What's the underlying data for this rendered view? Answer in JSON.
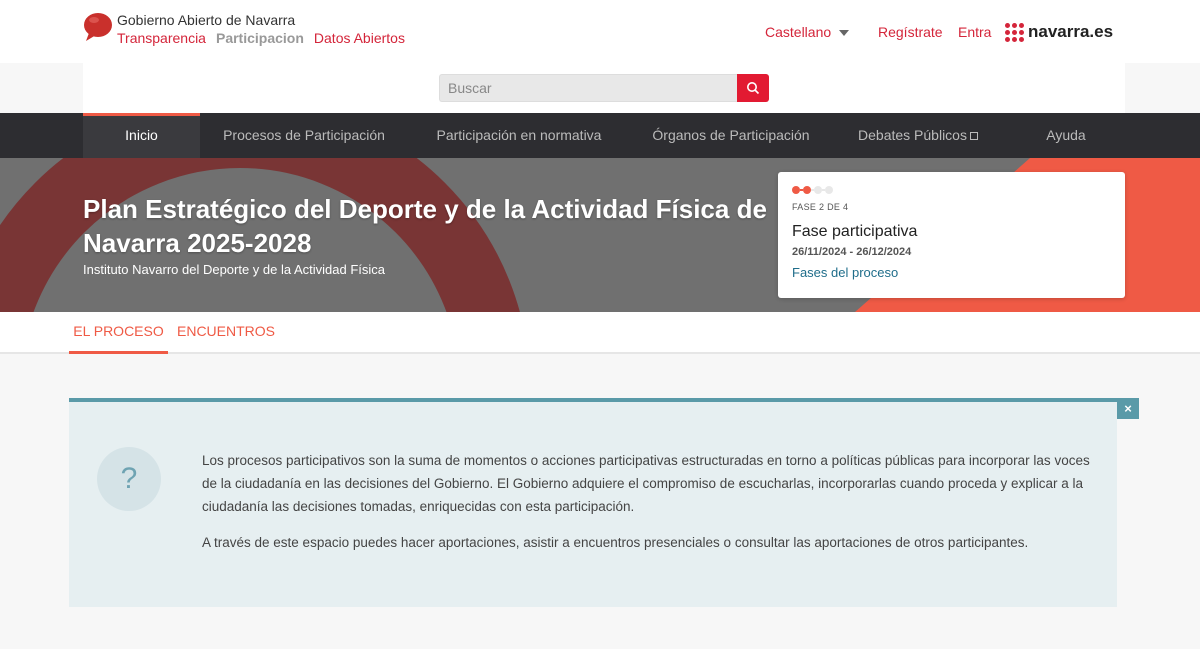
{
  "header": {
    "site_title": "Gobierno Abierto de Navarra",
    "subnav": [
      {
        "label": "Transparencia",
        "active": false
      },
      {
        "label": "Participacion",
        "active": true
      },
      {
        "label": "Datos Abiertos",
        "active": false
      }
    ],
    "language": "Castellano",
    "register": "Regístrate",
    "login": "Entra",
    "brand": "navarra.es"
  },
  "search": {
    "placeholder": "Buscar"
  },
  "mainnav": [
    {
      "label": "Inicio"
    },
    {
      "label": "Procesos de Participación"
    },
    {
      "label": "Participación en normativa"
    },
    {
      "label": "Órganos de Participación"
    },
    {
      "label": "Debates Públicos"
    },
    {
      "label": "Ayuda"
    }
  ],
  "hero": {
    "title": "Plan Estratégico del Deporte y de la Actividad Física de Navarra 2025-2028",
    "subtitle": "Instituto Navarro del Deporte y de la Actividad Física",
    "phase": {
      "label": "FASE 2 DE 4",
      "current": 2,
      "total": 4,
      "name": "Fase participativa",
      "dates": "26/11/2024 - 26/12/2024",
      "link": "Fases del proceso"
    }
  },
  "tabs": [
    {
      "label": "EL PROCESO"
    },
    {
      "label": "ENCUENTROS"
    }
  ],
  "info": {
    "icon": "question-icon",
    "close_label": "×",
    "paragraphs": [
      "Los procesos participativos son la suma de momentos o acciones participativas estructuradas en torno a políticas públicas para incorporar las voces de la ciudadanía en las decisiones del Gobierno. El Gobierno adquiere el compromiso de escucharlas, incorporarlas cuando proceda y explicar a la ciudadanía las decisiones tomadas, enriquecidas con esta participación.",
      " A través de este espacio puedes hacer aportaciones, asistir a encuentros presenciales o consultar las aportaciones de otros participantes."
    ]
  },
  "colors": {
    "accent": "#ef5a45",
    "brand_red": "#d4253a",
    "nav_bg": "#2d2d31",
    "info_border": "#5a9aa8"
  }
}
